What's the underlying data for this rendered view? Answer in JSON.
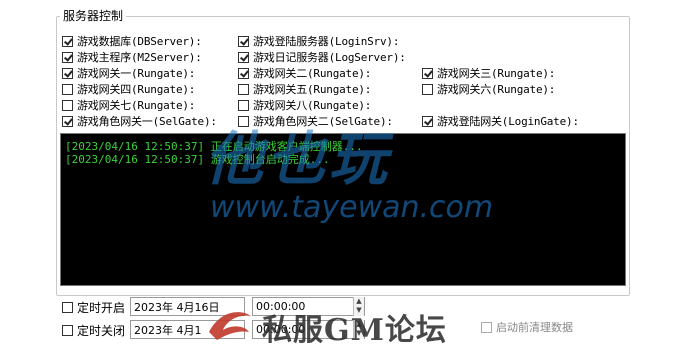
{
  "group": {
    "title": "服务器控制"
  },
  "checkboxes": [
    {
      "label": "游戏数据库(DBServer):",
      "checked": true
    },
    {
      "label": "游戏登陆服务器(LoginSrv):",
      "checked": true
    },
    {
      "label": "游戏主程序(M2Server):",
      "checked": true
    },
    {
      "label": "游戏日记服务器(LogServer):",
      "checked": true
    },
    {
      "label": "游戏网关一(Rungate):",
      "checked": true
    },
    {
      "label": "游戏网关二(Rungate):",
      "checked": true
    },
    {
      "label": "游戏网关三(Rungate):",
      "checked": true
    },
    {
      "label": "游戏网关四(Rungate):",
      "checked": false
    },
    {
      "label": "游戏网关五(Rungate):",
      "checked": false
    },
    {
      "label": "游戏网关六(Rungate):",
      "checked": false
    },
    {
      "label": "游戏网关七(Rungate):",
      "checked": false
    },
    {
      "label": "游戏网关八(Rungate):",
      "checked": false
    },
    {
      "label": "游戏角色网关一(SelGate):",
      "checked": true
    },
    {
      "label": "游戏角色网关二(SelGate):",
      "checked": false
    },
    {
      "label": "游戏登陆网关(LoginGate):",
      "checked": true
    }
  ],
  "log": [
    "[2023/04/16 12:50:37] 正在启动游戏客户端控制器...",
    "[2023/04/16 12:50:37] 游戏控制台启动完成..."
  ],
  "watermark": {
    "logo": "他也玩",
    "url": "www.tayewan.com",
    "bottom": "私服GM论坛"
  },
  "schedule": {
    "start_label": "定时开启",
    "stop_label": "定时关闭",
    "start_date": "2023年 4月16日",
    "stop_date": "2023年 4月1",
    "start_time": "00:00:00",
    "stop_time": "00:00:00",
    "cleanup_label": "启动前清理数据"
  }
}
